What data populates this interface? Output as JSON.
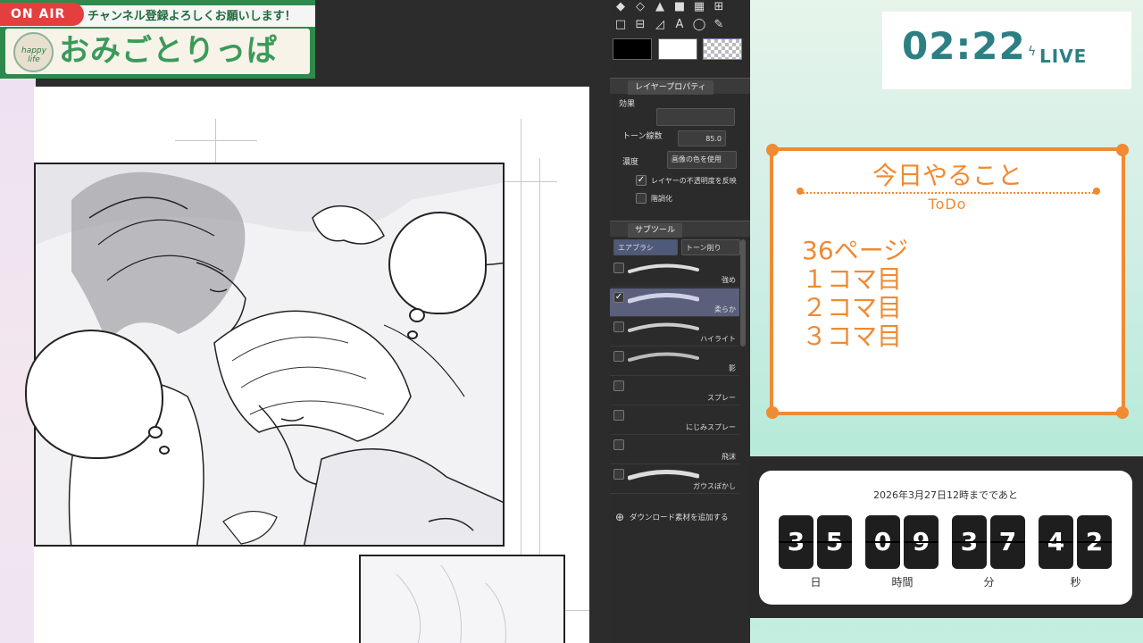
{
  "header": {
    "onair": "ON AIR",
    "message": "チャンネル登録よろしくお願いします！",
    "logo_text": "happy life",
    "title": "おみごとりっぱ"
  },
  "tool_panel": {
    "tools_row1": [
      "◆",
      "◇",
      "▲",
      "■",
      "▦",
      "⊞"
    ],
    "tools_row2": [
      "□",
      "⊟",
      "◿",
      "A",
      "◯",
      "✎"
    ],
    "colors": {
      "main": "#000000",
      "sub": "#ffffff"
    },
    "layer_property": {
      "tab": "レイヤープロパティ",
      "effect_label": "効果",
      "tone_lines_label": "トーン線数",
      "tone_lines_value": "85.0",
      "density_label": "濃度",
      "density_value": "画像の色を使用",
      "invert_label": "レイヤーの不透明度を反映",
      "posterize_label": "階調化"
    },
    "subtool": {
      "tab": "サブツール",
      "tabs": [
        "エアブラシ",
        "トーン削り"
      ],
      "items": [
        {
          "label": "強め",
          "checked": false,
          "selected": false
        },
        {
          "label": "柔らか",
          "checked": true,
          "selected": true
        },
        {
          "label": "ハイライト",
          "checked": false,
          "selected": false
        },
        {
          "label": "影",
          "checked": false,
          "selected": false
        },
        {
          "label": "スプレー",
          "checked": false,
          "selected": false
        },
        {
          "label": "にじみスプレー",
          "checked": false,
          "selected": false
        },
        {
          "label": "飛沫",
          "checked": false,
          "selected": false
        },
        {
          "label": "ガウスぼかし",
          "checked": false,
          "selected": false
        }
      ],
      "add_material": "ダウンロード素材を追加する"
    }
  },
  "clock": {
    "time": "02:22",
    "status": "LIVE"
  },
  "todo": {
    "title": "今日やること",
    "subtitle": "ToDo",
    "items": [
      "36ページ",
      "１コマ目",
      "２コマ目",
      "３コマ目"
    ]
  },
  "countdown": {
    "target": "2026年3月27日12時までであと",
    "days": [
      "3",
      "5"
    ],
    "hours": [
      "0",
      "9"
    ],
    "minutes": [
      "3",
      "7"
    ],
    "seconds": [
      "4",
      "2"
    ],
    "units": [
      "日",
      "時間",
      "分",
      "秒"
    ]
  },
  "colors": {
    "accent_orange": "#ef8a33",
    "teal": "#2c7f83",
    "header_green": "#2e8a4c",
    "onair_red": "#e53e3e"
  }
}
